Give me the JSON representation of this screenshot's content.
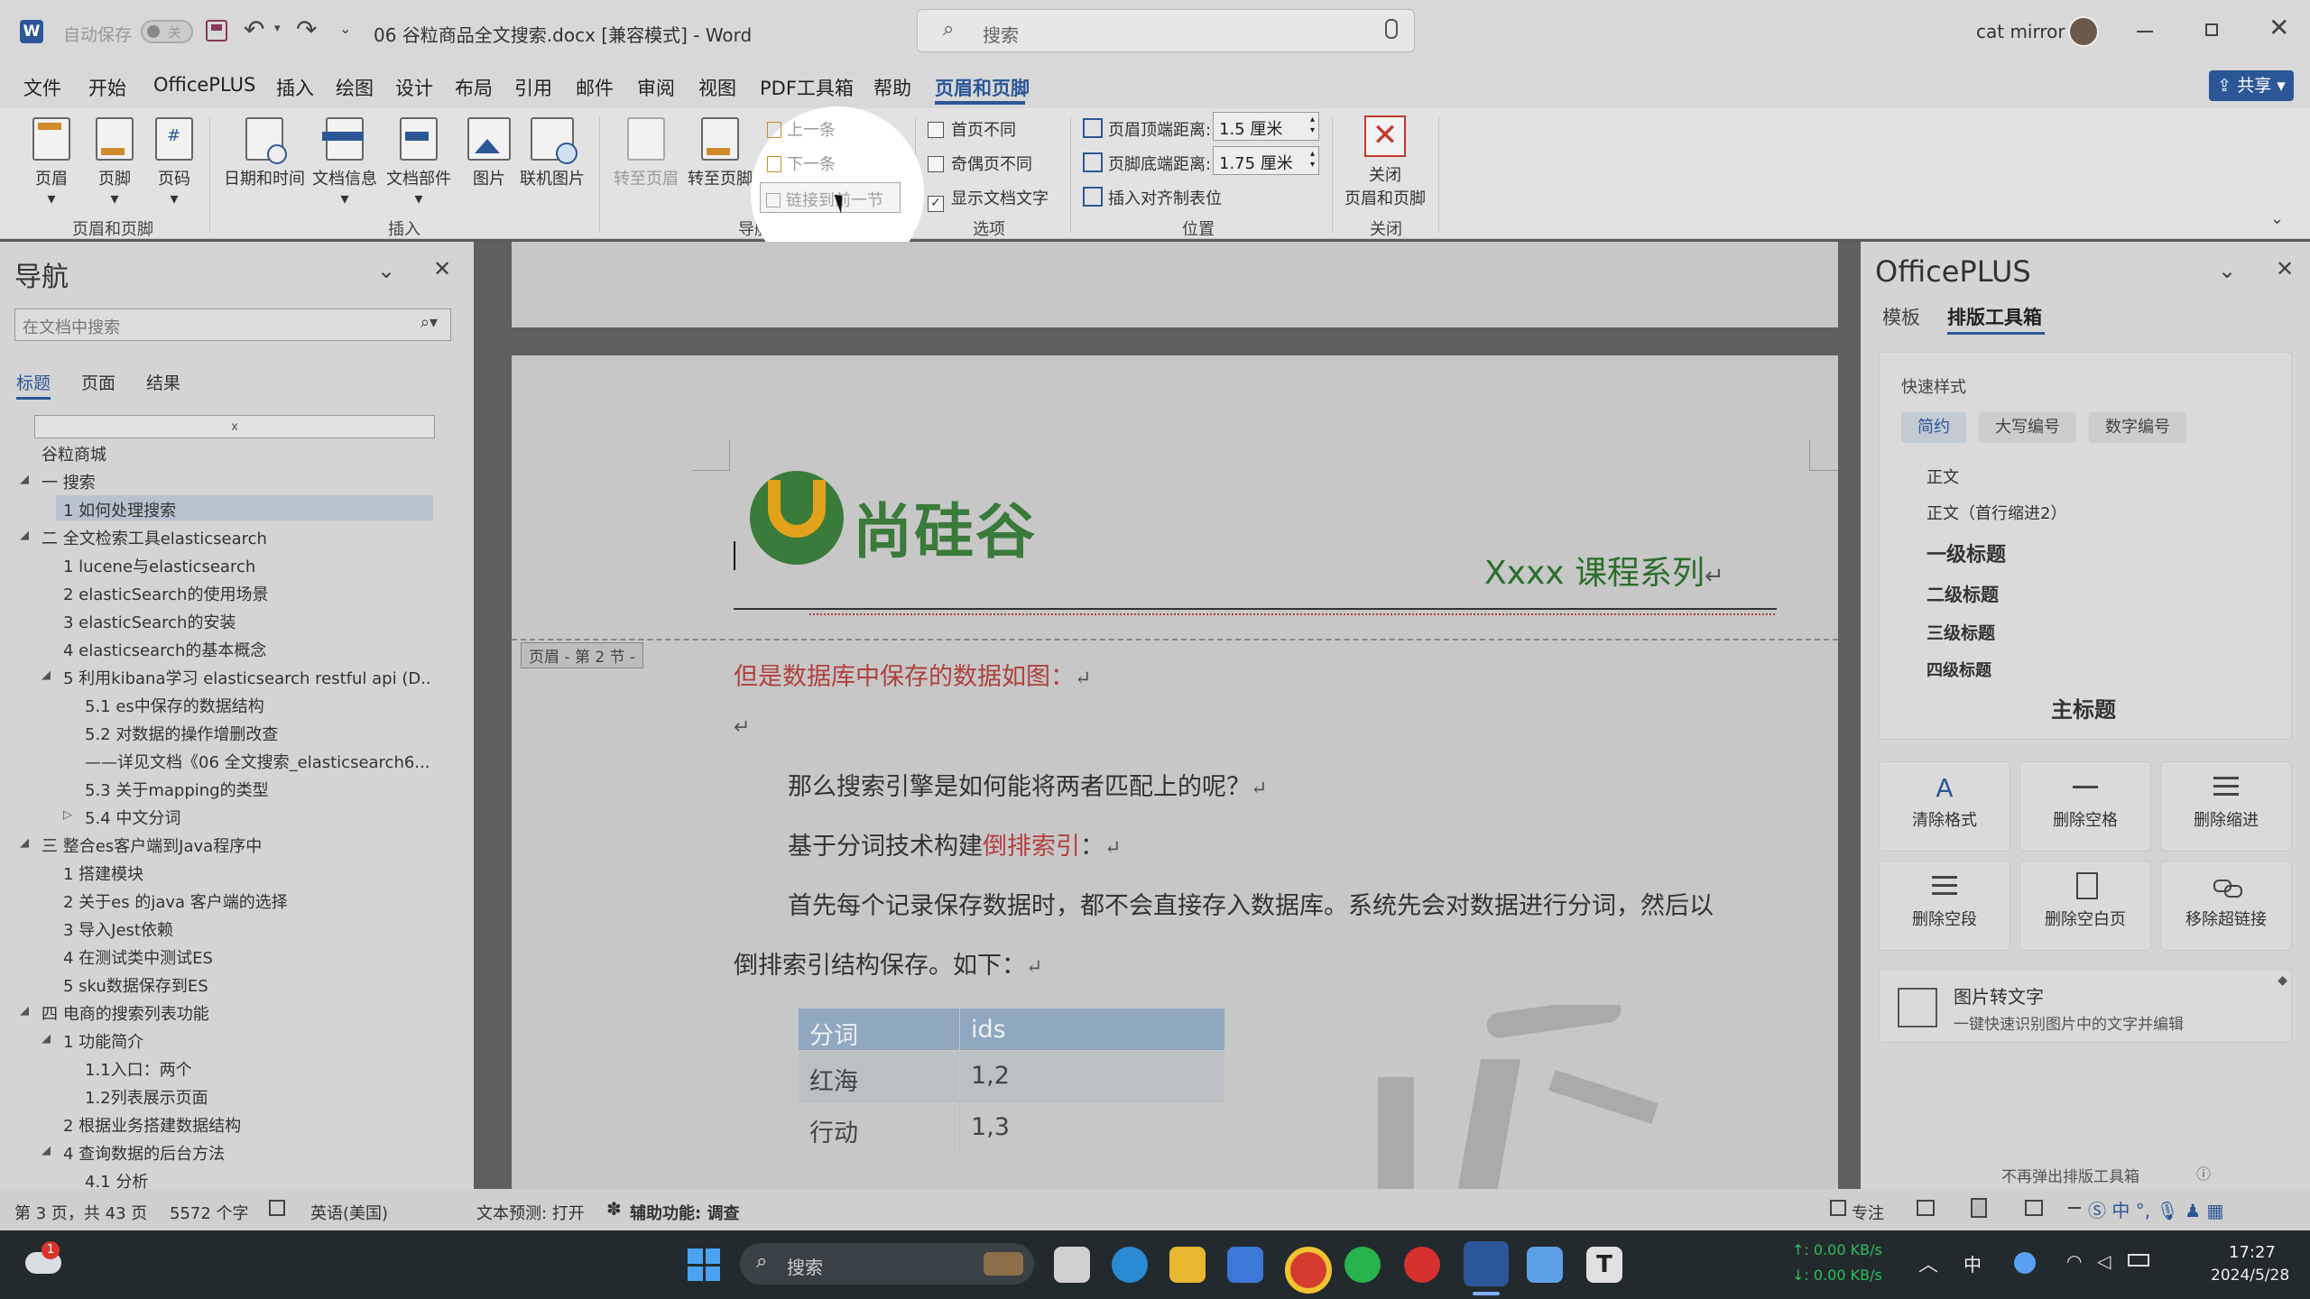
{
  "titlebar": {
    "autosave_label": "自动保存",
    "toggle_state": "关",
    "doc_title": "06 谷粒商品全文搜索.docx [兼容模式] - Word",
    "search_placeholder": "搜索",
    "user_name": "cat mirror"
  },
  "menu": {
    "items": [
      "文件",
      "开始",
      "OfficePLUS",
      "插入",
      "绘图",
      "设计",
      "布局",
      "引用",
      "邮件",
      "审阅",
      "视图",
      "PDF工具箱",
      "帮助",
      "页眉和页脚"
    ],
    "active": "页眉和页脚",
    "share": "共享"
  },
  "ribbon": {
    "header_footer": {
      "header": "页眉",
      "footer": "页脚",
      "page_no": "页码",
      "group": "页眉和页脚"
    },
    "insert": {
      "datetime": "日期和时间",
      "docinfo": "文档信息",
      "docparts": "文档部件",
      "picture": "图片",
      "online_picture": "联机图片",
      "group": "插入"
    },
    "nav": {
      "goto_header": "转至页眉",
      "goto_footer": "转至页脚",
      "prev": "上一条",
      "next": "下一条",
      "link_prev": "链接到前一节",
      "group": "导航"
    },
    "options": {
      "diff_first": "首页不同",
      "diff_odd_even": "奇偶页不同",
      "show_text": "显示文档文字",
      "group": "选项"
    },
    "position": {
      "header_top": "页眉顶端距离:",
      "header_top_val": "1.5 厘米",
      "footer_bottom": "页脚底端距离:",
      "footer_bottom_val": "1.75 厘米",
      "align_tab": "插入对齐制表位",
      "group": "位置"
    },
    "close": {
      "label_1": "关闭",
      "label_2": "页眉和页脚",
      "group": "关闭"
    }
  },
  "nav": {
    "title": "导航",
    "search_placeholder": "在文档中搜索",
    "tabs": [
      "标题",
      "页面",
      "结果"
    ],
    "active_tab": "标题",
    "items": [
      {
        "text": "谷粒商城",
        "indent": 0,
        "tri": ""
      },
      {
        "text": "一 搜索",
        "indent": 0,
        "tri": "◢"
      },
      {
        "text": "1   如何处理搜索",
        "indent": 1,
        "tri": "",
        "selected": true
      },
      {
        "text": "二 全文检索工具elasticsearch",
        "indent": 0,
        "tri": "◢"
      },
      {
        "text": "1   lucene与elasticsearch",
        "indent": 1,
        "tri": ""
      },
      {
        "text": "2   elasticSearch的使用场景",
        "indent": 1,
        "tri": ""
      },
      {
        "text": "3   elasticSearch的安装",
        "indent": 1,
        "tri": ""
      },
      {
        "text": "4   elasticsearch的基本概念",
        "indent": 1,
        "tri": ""
      },
      {
        "text": "5   利用kibana学习 elasticsearch restful api (D...",
        "indent": 1,
        "tri": "◢"
      },
      {
        "text": "5.1 es中保存的数据结构",
        "indent": 2,
        "tri": ""
      },
      {
        "text": "5.2 对数据的操作增删改查",
        "indent": 2,
        "tri": ""
      },
      {
        "text": "——详见文档《06 全文搜索_elasticsearch6....",
        "indent": 2,
        "tri": ""
      },
      {
        "text": "5.3 关于mapping的类型",
        "indent": 2,
        "tri": ""
      },
      {
        "text": "5.4 中文分词",
        "indent": 2,
        "tri": "▷"
      },
      {
        "text": "三 整合es客户端到Java程序中",
        "indent": 0,
        "tri": "◢"
      },
      {
        "text": "1   搭建模块",
        "indent": 1,
        "tri": ""
      },
      {
        "text": "2   关于es 的java 客户端的选择",
        "indent": 1,
        "tri": ""
      },
      {
        "text": "3   导入Jest依赖",
        "indent": 1,
        "tri": ""
      },
      {
        "text": "4   在测试类中测试ES",
        "indent": 1,
        "tri": ""
      },
      {
        "text": "5   sku数据保存到ES",
        "indent": 1,
        "tri": ""
      },
      {
        "text": "四 电商的搜索列表功能",
        "indent": 0,
        "tri": "◢"
      },
      {
        "text": "1 功能简介",
        "indent": 1,
        "tri": "◢"
      },
      {
        "text": "1.1入口：两个",
        "indent": 2,
        "tri": ""
      },
      {
        "text": "1.2列表展示页面",
        "indent": 2,
        "tri": ""
      },
      {
        "text": "2 根据业务搭建数据结构",
        "indent": 1,
        "tri": ""
      },
      {
        "text": "4 查询数据的后台方法",
        "indent": 1,
        "tri": "◢"
      },
      {
        "text": "4.1 分析",
        "indent": 2,
        "tri": ""
      }
    ]
  },
  "doc": {
    "logo_text": "尚硅谷",
    "header_right": "Xxxx 课程系列",
    "section_tag": "页眉 - 第 2 节 -",
    "line1": "但是数据库中保存的数据如图：",
    "line2": "那么搜索引擎是如何能将两者匹配上的呢？",
    "line3a": "基于分词技术构建",
    "line3b": "倒排索引",
    "line3c": "：",
    "line4": "首先每个记录保存数据时，都不会直接存入数据库。系统先会对数据进行分词，然后以",
    "line5": "倒排索引结构保存。如下：",
    "table": {
      "headers": [
        "分词",
        "ids"
      ],
      "rows": [
        [
          "红海",
          "1,2"
        ],
        [
          "行动",
          "1,3"
        ]
      ]
    }
  },
  "officeplus": {
    "title": "OfficePLUS",
    "tabs": [
      "模板",
      "排版工具箱"
    ],
    "active_tab": "排版工具箱",
    "quick_style": "快速样式",
    "style_tabs": [
      "简约",
      "大写编号",
      "数字编号"
    ],
    "styles": [
      "正文",
      "正文（首行缩进2）",
      "一级标题",
      "二级标题",
      "三级标题",
      "四级标题",
      "主标题"
    ],
    "tools": [
      "清除格式",
      "删除空格",
      "删除缩进",
      "删除空段",
      "删除空白页",
      "移除超链接"
    ],
    "ocr_title": "图片转文字",
    "ocr_desc": "一键快速识别图片中的文字并编辑",
    "footer": "不再弹出排版工具箱"
  },
  "status": {
    "page": "第 3 页，共 43 页",
    "words": "5572 个字",
    "lang": "英语(美国)",
    "predict": "文本预测: 打开",
    "access": "辅助功能: 调查",
    "focus": "专注"
  },
  "taskbar": {
    "search": "搜索",
    "badge": "1",
    "ime": "中",
    "net_up": "↑: 0.00 KB/s",
    "net_down": "↓: 0.00 KB/s",
    "time": "17:27",
    "date": "2024/5/28"
  },
  "colors": {
    "accent": "#2b5797",
    "red_text": "#b0413e",
    "green_text": "#2c6e2c",
    "table_header": "#8fa8c0"
  }
}
